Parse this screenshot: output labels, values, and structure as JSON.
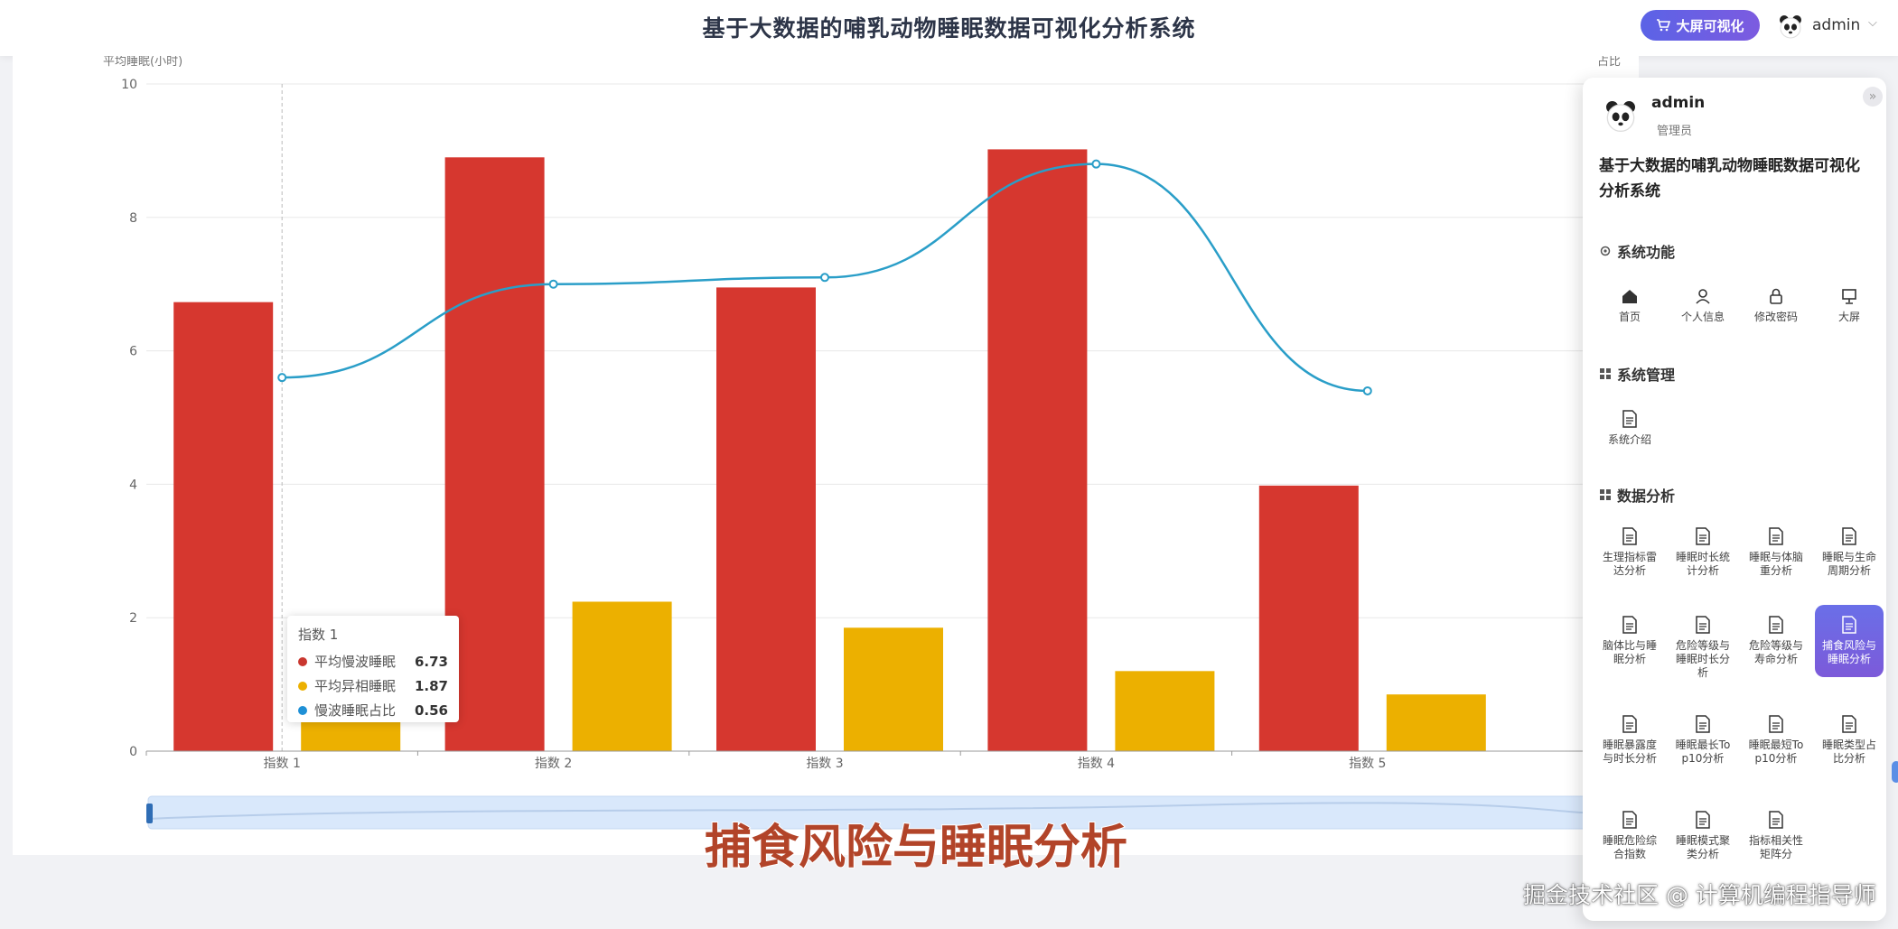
{
  "header": {
    "title": "基于大数据的哺乳动物睡眠数据可视化分析系统",
    "bigscreen_label": "大屏可视化",
    "username": "admin"
  },
  "chart_data": {
    "type": "bar",
    "categories": [
      "指数 1",
      "指数 2",
      "指数 3",
      "指数 4",
      "指数 5"
    ],
    "ylabel_left": "平均睡眠(小时)",
    "ylabel_right": "占比",
    "ylim": [
      0,
      10
    ],
    "yticks": [
      "0",
      "2",
      "4",
      "6",
      "8",
      "10"
    ],
    "series": [
      {
        "name": "平均慢波睡眠",
        "kind": "bar",
        "color": "#d6372f",
        "values": [
          6.73,
          8.9,
          6.95,
          9.02,
          3.98
        ]
      },
      {
        "name": "平均异相睡眠",
        "kind": "bar",
        "color": "#ecb000",
        "values": [
          1.87,
          2.24,
          1.85,
          1.2,
          0.85
        ]
      },
      {
        "name": "慢波睡眠占比",
        "kind": "line",
        "color": "#2a9ec8",
        "values": [
          0.56,
          0.7,
          0.71,
          0.88,
          0.54
        ],
        "ylim": [
          0,
          1
        ]
      }
    ],
    "grid": true
  },
  "tooltip": {
    "title": "指数 1",
    "rows": [
      {
        "name": "平均慢波睡眠",
        "value": "6.73",
        "color": "#c9372f"
      },
      {
        "name": "平均异相睡眠",
        "value": "1.87",
        "color": "#ecb000"
      },
      {
        "name": "慢波睡眠占比",
        "value": "0.56",
        "color": "#1e90d6"
      }
    ]
  },
  "caption": "捕食风险与睡眠分析",
  "watermark": "掘金技术社区 @ 计算机编程指导师",
  "panel": {
    "username": "admin",
    "role": "管理员",
    "system_name": "基于大数据的哺乳动物睡眠数据可视化分析系统",
    "sections": {
      "system_function": "系统功能",
      "system_management": "系统管理",
      "data_analysis": "数据分析"
    },
    "function_items": [
      "首页",
      "个人信息",
      "修改密码",
      "大屏"
    ],
    "management_items": [
      "系统介绍"
    ],
    "analysis_items": [
      "生理指标雷达分析",
      "睡眠时长统计分析",
      "睡眠与体脑重分析",
      "睡眠与生命周期分析",
      "脑体比与睡眠分析",
      "危险等级与睡眠时长分析",
      "危险等级与寿命分析",
      "捕食风险与睡眠分析",
      "睡眠暴露度与时长分析",
      "睡眠最长Top10分析",
      "睡眠最短Top10分析",
      "睡眠类型占比分析",
      "睡眠危险综合指数",
      "睡眠模式聚类分析",
      "指标相关性矩阵分"
    ],
    "active_item": "捕食风险与睡眠分析"
  }
}
